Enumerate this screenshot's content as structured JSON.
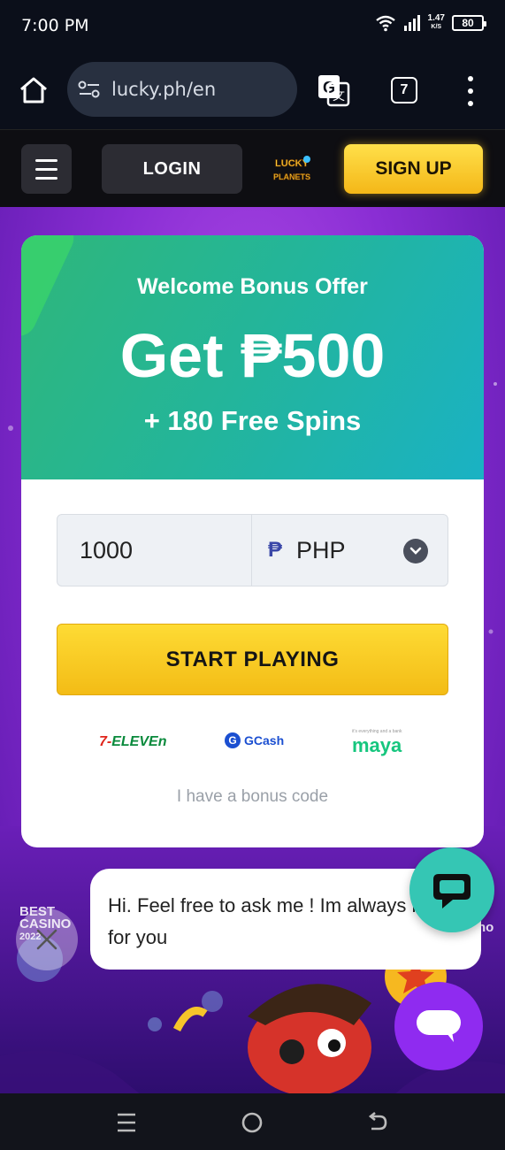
{
  "status": {
    "time": "7:00 PM",
    "speed_value": "1.47",
    "speed_unit": "K/S",
    "battery": "80"
  },
  "browser": {
    "url": "lucky.ph/en",
    "tab_count": "7"
  },
  "site_header": {
    "login_label": "LOGIN",
    "signup_label": "SIGN UP",
    "logo_line1": "LUCKY",
    "logo_line2": "PLANETS"
  },
  "bonus": {
    "title": "Welcome Bonus Offer",
    "amount": "Get ₱500",
    "spins": "+ 180 Free Spins",
    "deposit_value": "1000",
    "currency_symbol": "₱",
    "currency": "PHP",
    "start_label": "START PLAYING",
    "bonus_code_link": "I have a bonus code"
  },
  "payments": {
    "seven": "7-",
    "eleven": "ELEVEn",
    "gcash": "GCash",
    "maya": "maya",
    "maya_tagline": "it's everything and a bank"
  },
  "badges": {
    "best_line1": "BEST",
    "best_line2": "CASINO",
    "best_line3": "2022",
    "right": "no"
  },
  "chat": {
    "message": "Hi. Feel free to ask me ! Im always here for you"
  },
  "colors": {
    "accent_yellow": "#fedb34",
    "card_green": "#23b59b",
    "chat_teal": "#35c6b4",
    "launcher_purple": "#8f2bf0",
    "bg_purple": "#8a2ed4"
  }
}
